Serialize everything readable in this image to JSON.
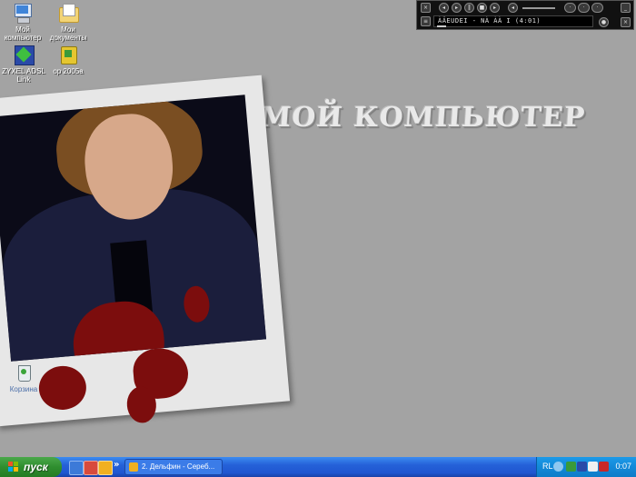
{
  "desktop": {
    "icons": [
      {
        "label": "Мой\nкомпьютер"
      },
      {
        "label": "Мои\nдокументы"
      },
      {
        "label": "ZYXEL ADSL\nLink"
      },
      {
        "label": "op 2005a"
      },
      {
        "label": "Корзина"
      }
    ],
    "title": "МОЙ КОМПЬЮТЕР"
  },
  "player": {
    "track": "ÀÄEUDEI - NÀ ÀÀ I (4:01)",
    "buttons": [
      "prev-icon",
      "play-icon",
      "pause-icon",
      "stop-icon",
      "next-icon",
      "volume-icon"
    ]
  },
  "taskbar": {
    "start_label": "пуск",
    "chevron": "»",
    "task_label": "2. Дельфин - Сереб...",
    "lang": "RL",
    "clock": "0:07"
  },
  "colors": {
    "desktop_bg": "#a3a3a3",
    "taskbar": "#245edb",
    "start": "#3a9a3a",
    "blood": "#7c0d0d"
  }
}
